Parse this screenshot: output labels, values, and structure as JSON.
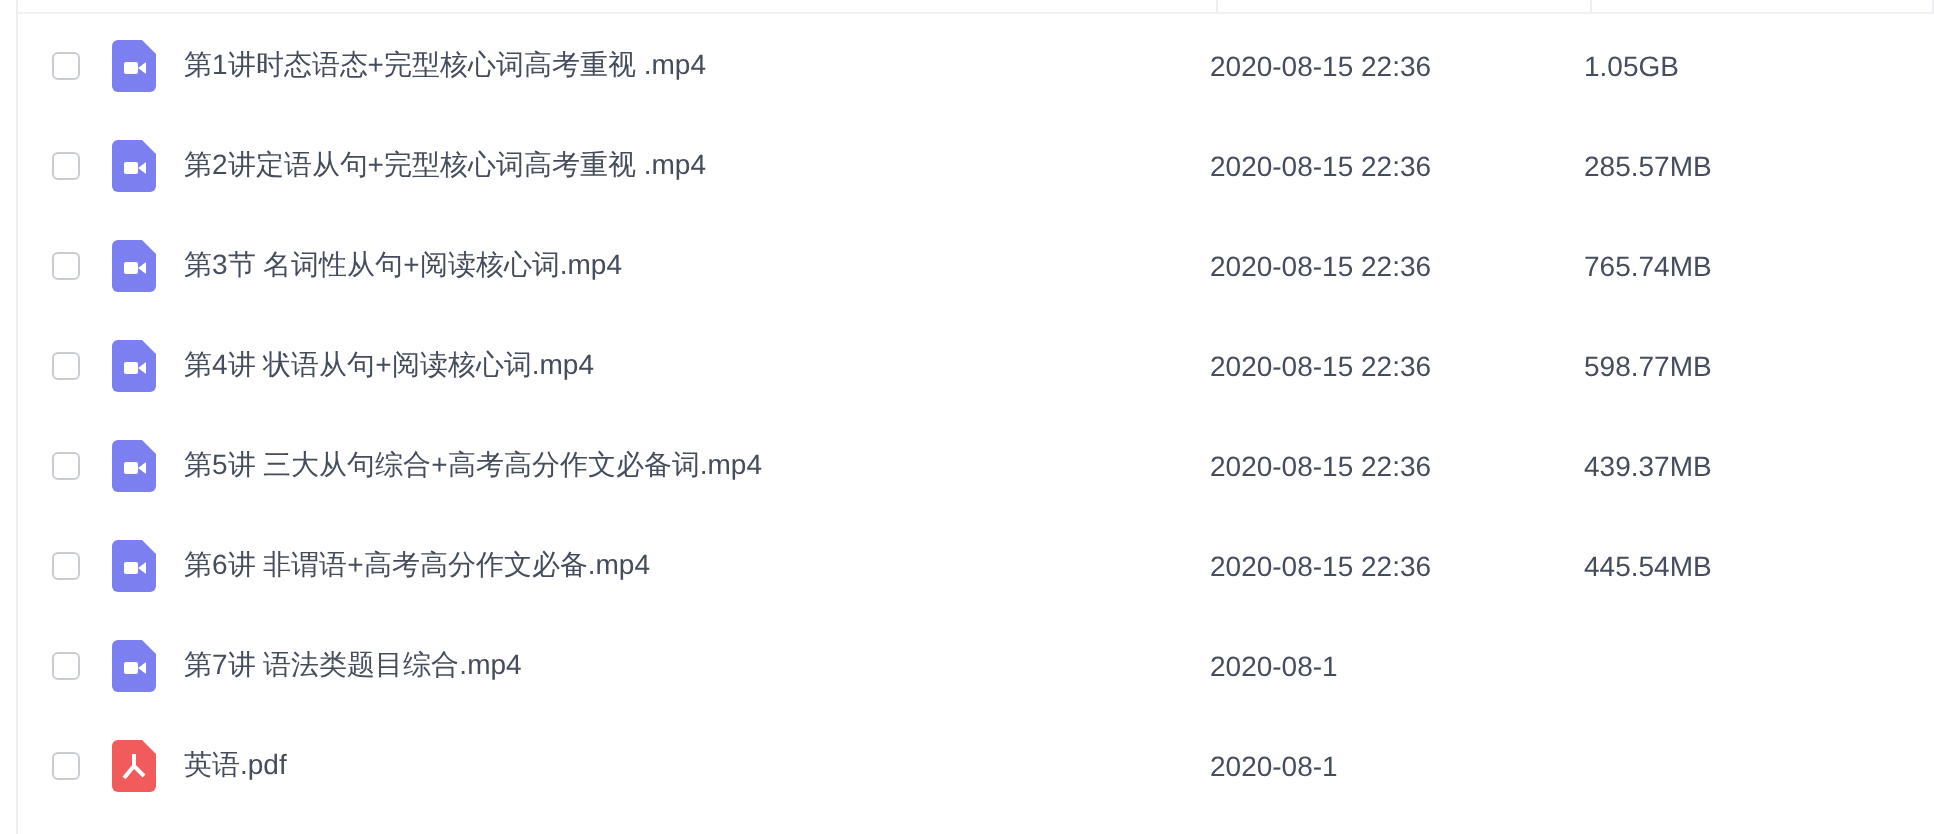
{
  "files": [
    {
      "kind": "video",
      "name": "第1讲时态语态+完型核心词高考重视 .mp4",
      "checked": false,
      "date": "2020-08-15 22:36",
      "size": "1.05GB"
    },
    {
      "kind": "video",
      "name": "第2讲定语从句+完型核心词高考重视 .mp4",
      "checked": false,
      "date": "2020-08-15 22:36",
      "size": "285.57MB"
    },
    {
      "kind": "video",
      "name": "第3节 名词性从句+阅读核心词.mp4",
      "checked": false,
      "date": "2020-08-15 22:36",
      "size": "765.74MB"
    },
    {
      "kind": "video",
      "name": "第4讲 状语从句+阅读核心词.mp4",
      "checked": false,
      "date": "2020-08-15 22:36",
      "size": "598.77MB"
    },
    {
      "kind": "video",
      "name": "第5讲 三大从句综合+高考高分作文必备词.mp4",
      "checked": false,
      "date": "2020-08-15 22:36",
      "size": "439.37MB"
    },
    {
      "kind": "video",
      "name": "第6讲 非谓语+高考高分作文必备.mp4",
      "checked": false,
      "date": "2020-08-15 22:36",
      "size": "445.54MB"
    },
    {
      "kind": "video",
      "name": "第7讲 语法类题目综合.mp4",
      "checked": false,
      "date": "2020-08-1"
    },
    {
      "kind": "pdf",
      "name": "英语.pdf",
      "checked": false,
      "date": "2020-08-1"
    }
  ]
}
